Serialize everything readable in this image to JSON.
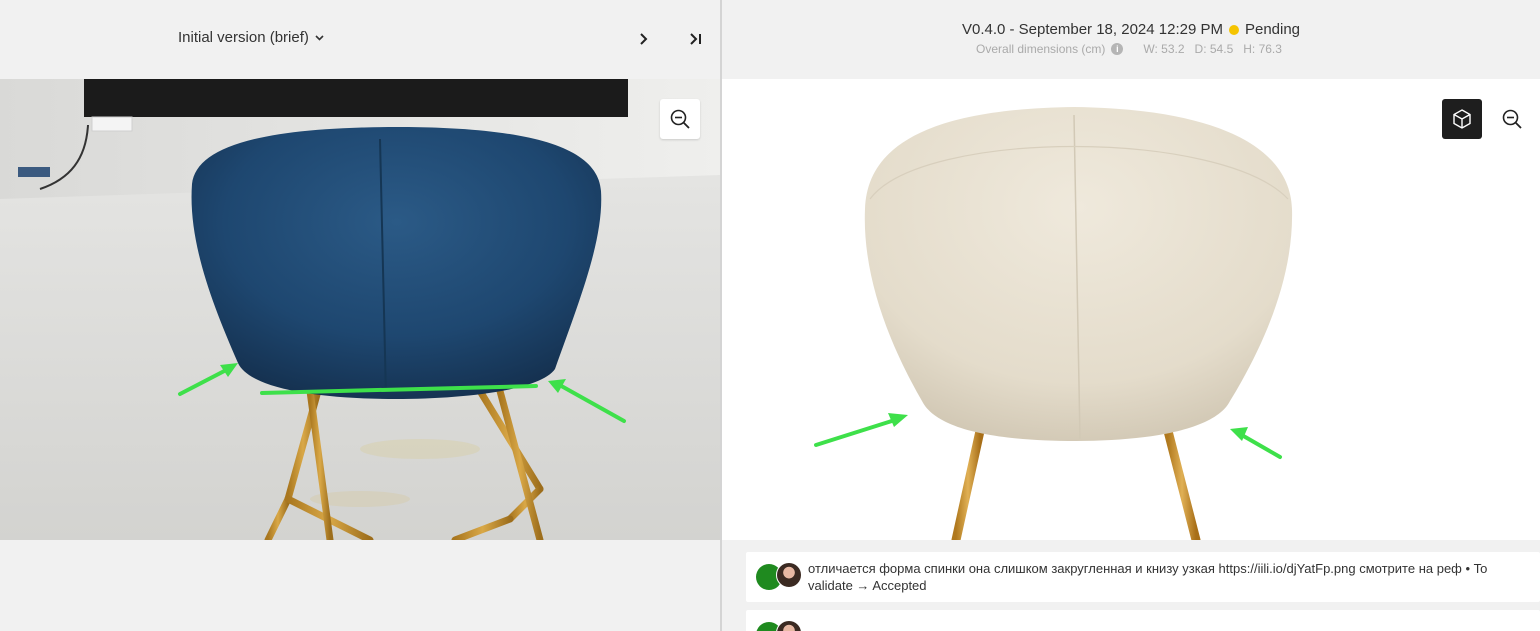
{
  "left_panel": {
    "version_selector": "Initial version (brief)"
  },
  "right_panel": {
    "version_label": "V0.4.0 - September 18, 2024 12:29 PM",
    "status": "Pending",
    "status_color": "#f5c400",
    "dimensions_label": "Overall dimensions (cm)",
    "width": "W: 53.2",
    "depth": "D: 54.5",
    "height": "H: 76.3"
  },
  "comments": [
    {
      "text": "отличается форма спинки она слишком закругленная и книзу узкая https://iili.io/djYatFp.png смотрите на реф • To validate → Accepted"
    }
  ],
  "colors": {
    "annotation_arrow": "#3ee04a",
    "chair_reference_fabric": "#1e4770",
    "chair_model_fabric": "#e9e2d4",
    "chair_legs": "#c8962f"
  }
}
